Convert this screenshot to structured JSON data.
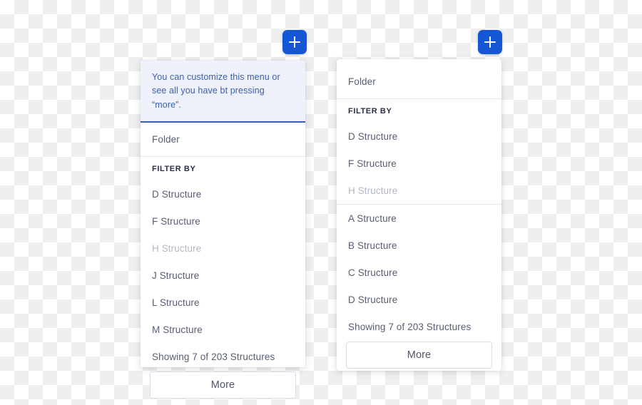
{
  "colors": {
    "accent_blue": "#1556d4",
    "banner_bg": "#eef1f9",
    "banner_text": "#3b5fae",
    "banner_border": "#2f5fc4",
    "item_text": "#585d74",
    "disabled_text": "#b3b6c9",
    "label_text": "#2a2e45",
    "divider": "#e7e9f0",
    "panel_bg": "#ffffff"
  },
  "left_menu": {
    "add_button": {
      "icon": "plus-icon",
      "label": "+"
    },
    "banner": {
      "text": "You can customize this menu or see all you have bt pressing “more”."
    },
    "folder_label": "Folder",
    "section_label": "FILTER BY",
    "items": [
      {
        "label": "D Structure",
        "disabled": false
      },
      {
        "label": "F Structure",
        "disabled": false
      },
      {
        "label": "H Structure",
        "disabled": true
      },
      {
        "label": "J Structure",
        "disabled": false
      },
      {
        "label": "L Structure",
        "disabled": false
      },
      {
        "label": "M Structure",
        "disabled": false
      }
    ],
    "showing_text": "Showing 7 of 203 Structures",
    "more_label": "More"
  },
  "right_menu": {
    "add_button": {
      "icon": "plus-icon",
      "label": "+"
    },
    "folder_label": "Folder",
    "section_label": "FILTER BY",
    "items_group_one": [
      {
        "label": "D Structure",
        "disabled": false
      },
      {
        "label": "F Structure",
        "disabled": false
      },
      {
        "label": "H Structure",
        "disabled": true
      }
    ],
    "items_group_two": [
      {
        "label": "A Structure",
        "disabled": false
      },
      {
        "label": "B Structure",
        "disabled": false
      },
      {
        "label": "C Structure",
        "disabled": false
      },
      {
        "label": "D Structure",
        "disabled": false
      }
    ],
    "showing_text": "Showing 7 of 203 Structures",
    "more_label": "More"
  }
}
